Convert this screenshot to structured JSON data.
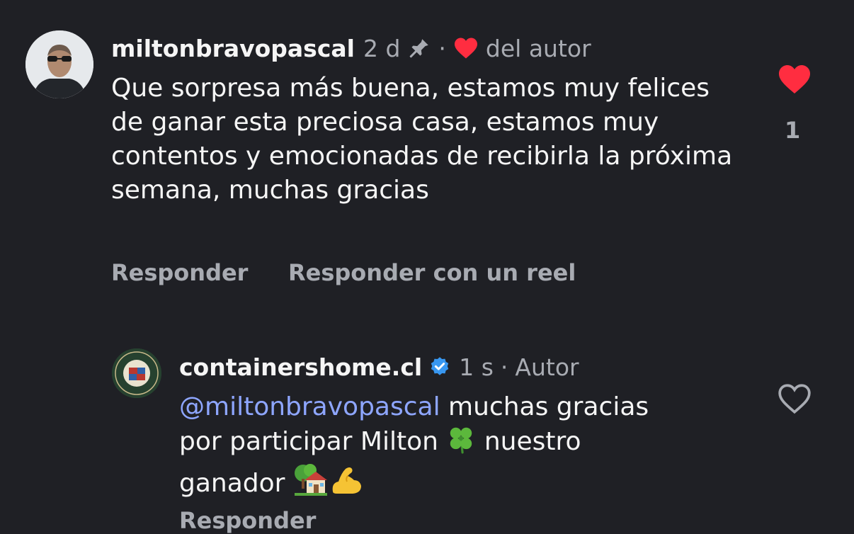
{
  "comment": {
    "username": "miltonbravopascal",
    "time": "2 d",
    "separator": "·",
    "liked_by_author_label": "del autor",
    "text": "Que sorpresa más buena, estamos muy felices de ganar esta preciosa casa, estamos muy contentos y emocionadas de recibirla la próxima semana, muchas gracias",
    "like_count": "1",
    "reply_label": "Responder",
    "reply_reel_label": "Responder con un reel"
  },
  "reply": {
    "username": "containershome.cl",
    "time": "1 s",
    "separator": "·",
    "author_label": "Autor",
    "mention": "@miltonbravopascal",
    "text_line1": " muchas gracias",
    "text_line2": "por participar Milton",
    "text_line2_after": " nuestro",
    "text_line3": "ganador",
    "reply_label": "Responder"
  },
  "icons": {
    "pin": "pin-icon",
    "heart_filled": "heart-filled-icon",
    "heart_outline": "heart-outline-icon",
    "verified": "verified-badge-icon",
    "clover": "four-leaf-clover-emoji",
    "house": "house-with-garden-emoji",
    "muscle": "flexed-biceps-emoji"
  },
  "colors": {
    "background": "#1f2025",
    "text": "#f5f5f5",
    "muted": "#a8abb2",
    "mention": "#8ea6ff",
    "heart": "#ff2d40",
    "verified": "#3897f0"
  }
}
